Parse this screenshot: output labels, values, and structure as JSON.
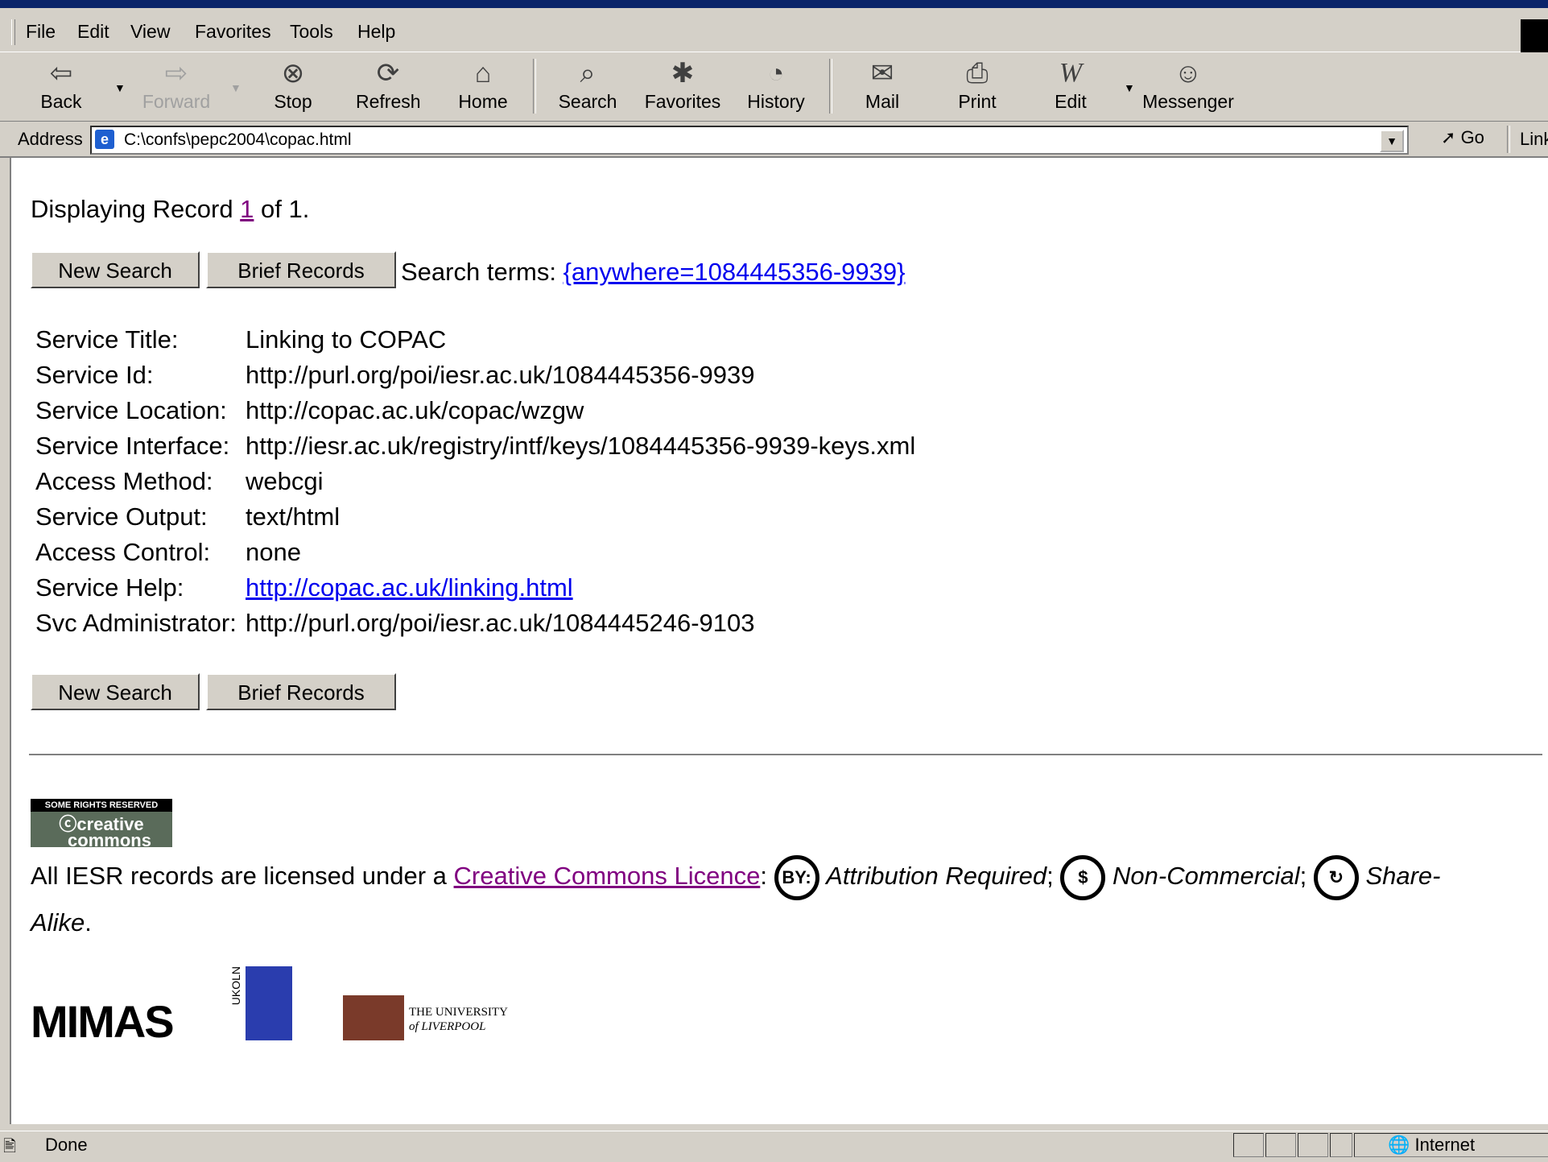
{
  "menubar": {
    "items": [
      "File",
      "Edit",
      "View",
      "Favorites",
      "Tools",
      "Help"
    ]
  },
  "toolbar": {
    "back": "Back",
    "forward": "Forward",
    "stop": "Stop",
    "refresh": "Refresh",
    "home": "Home",
    "search": "Search",
    "favorites": "Favorites",
    "history": "History",
    "mail": "Mail",
    "print": "Print",
    "edit": "Edit",
    "messenger": "Messenger"
  },
  "address": {
    "label": "Address",
    "url": "C:\\confs\\pepc2004\\copac.html",
    "go": "Go",
    "links": "Links"
  },
  "page": {
    "displaying_prefix": "Displaying Record ",
    "record_link": "1",
    "displaying_suffix": " of 1.",
    "new_search": "New Search",
    "brief_records": "Brief Records",
    "search_terms_label": "Search terms: ",
    "search_terms_link": "{anywhere=1084445356-9939}",
    "fields": [
      {
        "label": "Service Title:",
        "value": "Linking to COPAC"
      },
      {
        "label": "Service Id:",
        "value": "http://purl.org/poi/iesr.ac.uk/1084445356-9939"
      },
      {
        "label": "Service Location:",
        "value": "http://copac.ac.uk/copac/wzgw"
      },
      {
        "label": "Service Interface:",
        "value": "http://iesr.ac.uk/registry/intf/keys/1084445356-9939-keys.xml"
      },
      {
        "label": "Access Method:",
        "value": "webcgi"
      },
      {
        "label": "Service Output:",
        "value": "text/html"
      },
      {
        "label": "Access Control:",
        "value": "none"
      },
      {
        "label": "Service Help:",
        "value": "http://copac.ac.uk/linking.html"
      },
      {
        "label": "Svc Administrator:",
        "value": "http://purl.org/poi/iesr.ac.uk/1084445246-9103"
      }
    ],
    "cc_badge_top": "SOME RIGHTS RESERVED",
    "cc_badge_bottom_1": "creative",
    "cc_badge_bottom_2": "commons",
    "license_prefix": "All IESR records are licensed under a ",
    "license_link": "Creative Commons Licence",
    "license_colon": ": ",
    "by_icon_text": "BY:",
    "attribution": "Attribution Required",
    "non_commercial": "Non-Commercial",
    "share_alike_1": "Share-",
    "share_alike_2": "Alike",
    "mimas": "MIMAS",
    "ukoln": "UKOLN",
    "liverpool_1": "THE UNIVERSITY",
    "liverpool_2": "of LIVERPOOL"
  },
  "status": {
    "text": "Done",
    "zone": "Internet"
  },
  "colors": {
    "link": "#0000ee",
    "visited": "#800080",
    "chrome": "#d4d0c8"
  }
}
